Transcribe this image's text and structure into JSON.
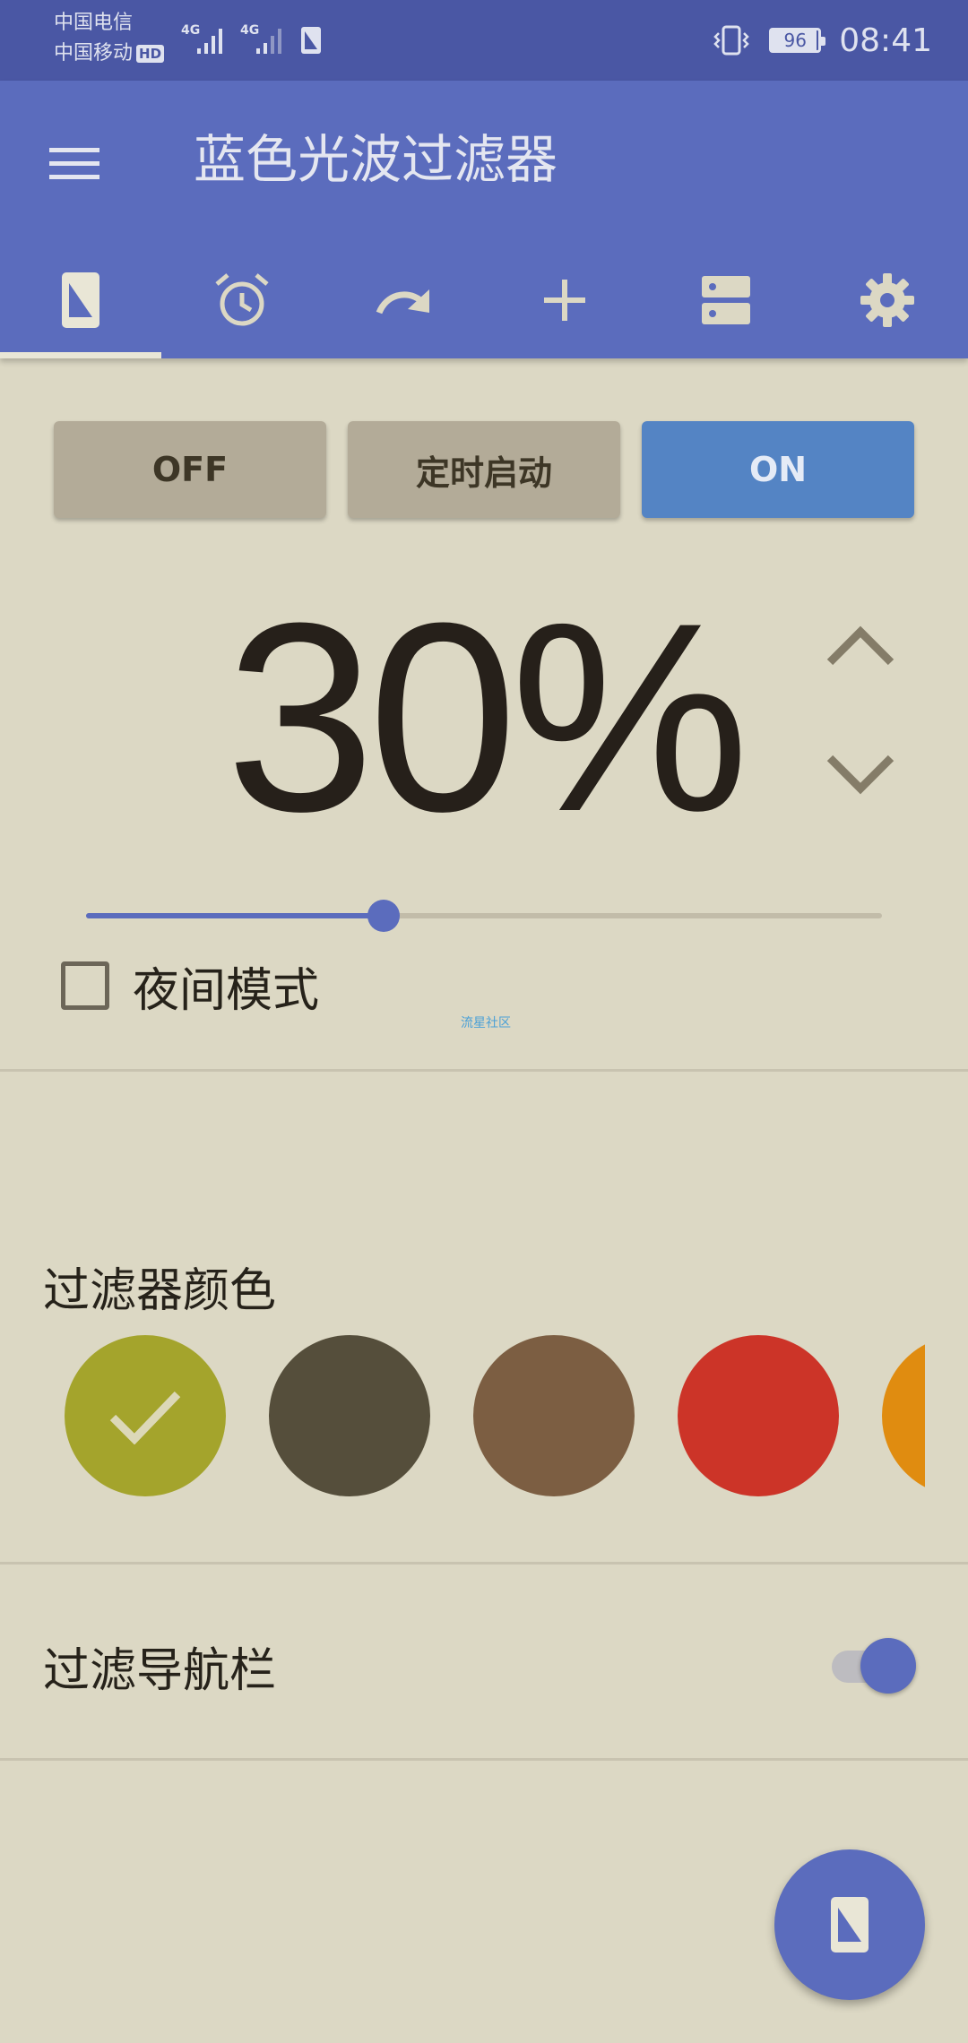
{
  "status_bar": {
    "carrier_1": "中国电信",
    "carrier_2": "中国移动",
    "hd_badge": "HD",
    "network_1": "4G",
    "network_2": "4G",
    "battery_level": "96",
    "battery_fraction": 0.96,
    "time": "08:41"
  },
  "app_bar": {
    "title": "蓝色光波过滤器",
    "menu_icon": "hamburger-menu-icon",
    "tabs": [
      {
        "icon": "screen-filter-icon",
        "selected": true
      },
      {
        "icon": "alarm-clock-icon",
        "selected": false
      },
      {
        "icon": "redo-arrow-icon",
        "selected": false
      },
      {
        "icon": "plus-icon",
        "selected": false
      },
      {
        "icon": "storage-icon",
        "selected": false
      },
      {
        "icon": "gear-icon",
        "selected": false
      }
    ]
  },
  "controls": {
    "off_label": "OFF",
    "timer_label": "定时启动",
    "on_label": "ON",
    "active_mode": "ON"
  },
  "intensity": {
    "percent_text": "30%",
    "slider_value": 0.374
  },
  "night_mode": {
    "label": "夜间模式",
    "checked": false
  },
  "watermark": "流星社区",
  "filter_color": {
    "title": "过滤器颜色",
    "swatches": [
      {
        "color": "#a4a42c",
        "selected": true
      },
      {
        "color": "#554e3b",
        "selected": false
      },
      {
        "color": "#7c5e42",
        "selected": false
      },
      {
        "color": "#cc3428",
        "selected": false
      },
      {
        "color": "#e08c10",
        "selected": false
      }
    ]
  },
  "nav_bar_filter": {
    "label": "过滤导航栏",
    "enabled": true
  },
  "fab": {
    "icon": "screen-filter-icon"
  },
  "colors": {
    "status_bar": "#4a57a4",
    "primary": "#5b6cbd",
    "on_button": "#5484c4",
    "background": "#dcd8c4"
  }
}
